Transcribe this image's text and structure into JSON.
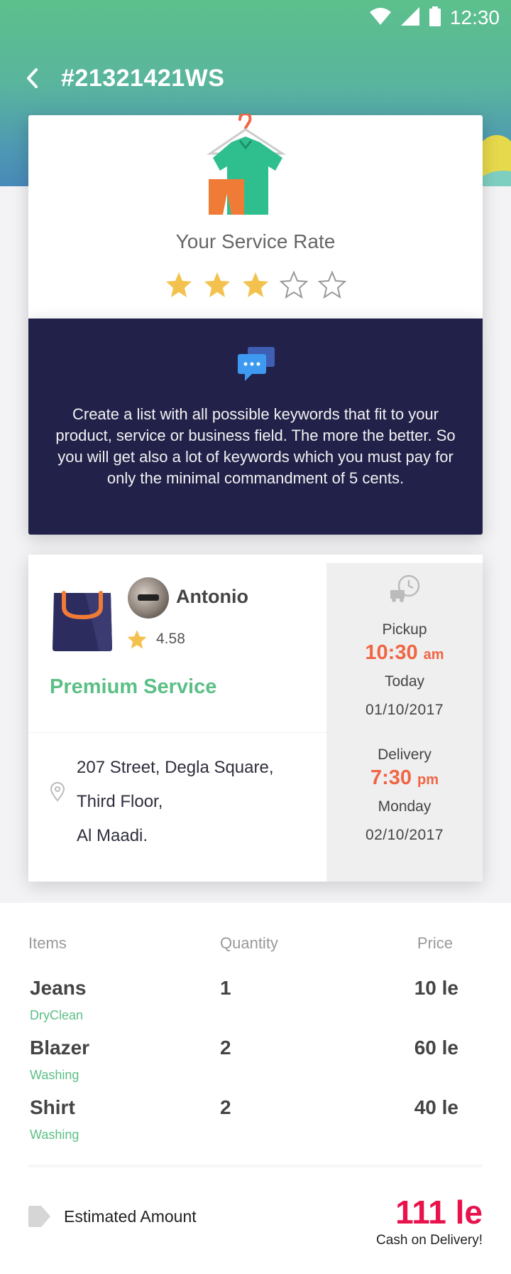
{
  "status_bar": {
    "time": "12:30"
  },
  "header": {
    "order_id": "#21321421WS"
  },
  "rating_card": {
    "title": "Your Service Rate",
    "rating": 3,
    "max_rating": 5
  },
  "tip": {
    "text": "Create a list with all possible keywords that fit to your product, service or business field. The more the better. So you will get also a lot of keywords which you must pay for only the minimal commandment of 5 cents."
  },
  "provider": {
    "name": "Antonio",
    "rating": "4.58",
    "service_type": "Premium Service",
    "address_lines": [
      "207 Street, Degla Square,",
      "Third Floor,",
      "Al Maadi."
    ]
  },
  "pickup": {
    "label": "Pickup",
    "time": "10:30",
    "ampm": "am",
    "day": "Today",
    "date": "01/10/2017"
  },
  "delivery": {
    "label": "Delivery",
    "time": "7:30",
    "ampm": "pm",
    "day": "Monday",
    "date": "02/10/2017"
  },
  "items_table": {
    "headers": {
      "items": "Items",
      "quantity": "Quantity",
      "price": "Price"
    },
    "rows": [
      {
        "name": "Jeans",
        "service": "DryClean",
        "qty": "1",
        "price": "10 le"
      },
      {
        "name": "Blazer",
        "service": "Washing",
        "qty": "2",
        "price": "60 le"
      },
      {
        "name": "Shirt",
        "service": "Washing",
        "qty": "2",
        "price": "40 le"
      }
    ]
  },
  "estimate": {
    "label": "Estimated Amount",
    "amount": "111 le",
    "payment": "Cash on Delivery!"
  },
  "colors": {
    "accent_green": "#5cbf86",
    "time_orange": "#f06543",
    "amount_red": "#e8134d",
    "tip_bg": "#22214a",
    "star_gold": "#f3c24e"
  },
  "icons": [
    "back-arrow-icon",
    "wifi-icon",
    "signal-icon",
    "battery-icon",
    "hanger-clothes-icon",
    "star-icon",
    "chat-bubbles-icon",
    "shopping-bag-icon",
    "clock-truck-icon",
    "location-pin-icon",
    "tag-icon"
  ]
}
